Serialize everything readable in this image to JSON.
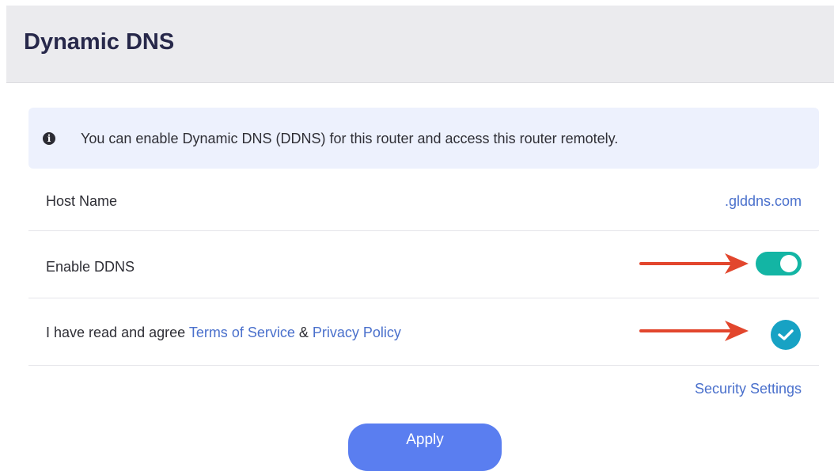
{
  "header": {
    "title": "Dynamic DNS"
  },
  "notice": {
    "icon": "info-icon",
    "text": "You can enable Dynamic DNS (DDNS) for this router and access this router remotely."
  },
  "host": {
    "label": "Host Name",
    "value": ".glddns.com"
  },
  "ddns": {
    "label": "Enable DDNS",
    "enabled": true,
    "toggle_color": "#13b5a4"
  },
  "agree": {
    "prefix": "I have read and agree ",
    "terms_link": "Terms of Service",
    "ampersand": " & ",
    "privacy_link": "Privacy Policy",
    "checked": true,
    "check_color": "#17a2c4"
  },
  "security_link": "Security Settings",
  "apply_label": "Apply",
  "colors": {
    "accent": "#5a7ef0",
    "link": "#4a70cc",
    "annotation_arrow": "#e2462d"
  }
}
